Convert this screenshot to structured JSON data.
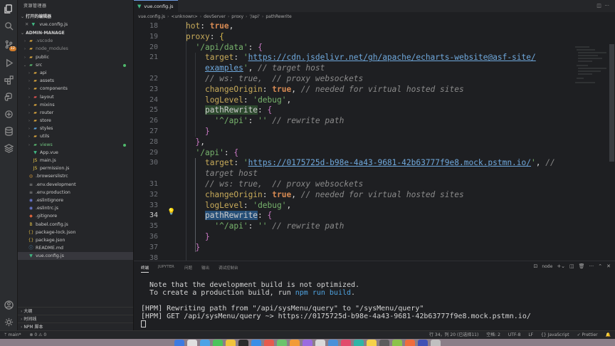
{
  "sidebar": {
    "title": "资源管理器",
    "open_editors_label": "打开的编辑器",
    "open_editors": [
      {
        "close": "✕",
        "name": "vue.config.js"
      }
    ],
    "project_label": "ADMIN-MANAGE",
    "tree": [
      {
        "name": ".vscode",
        "kind": "folder",
        "depth": 1,
        "chev": "›"
      },
      {
        "name": "node_modules",
        "kind": "folder",
        "depth": 1,
        "chev": "›"
      },
      {
        "name": "public",
        "kind": "folder",
        "depth": 1,
        "chev": "›"
      },
      {
        "name": "src",
        "kind": "folder-src",
        "depth": 1,
        "chev": "⌄",
        "dot": true
      },
      {
        "name": "api",
        "kind": "folder",
        "depth": 2,
        "chev": "›"
      },
      {
        "name": "assets",
        "kind": "folder",
        "depth": 2,
        "chev": "›"
      },
      {
        "name": "components",
        "kind": "folder",
        "depth": 2,
        "chev": "›"
      },
      {
        "name": "layout",
        "kind": "folder-red",
        "depth": 2,
        "chev": "›"
      },
      {
        "name": "mixins",
        "kind": "folder",
        "depth": 2,
        "chev": "›"
      },
      {
        "name": "router",
        "kind": "folder",
        "depth": 2,
        "chev": "›"
      },
      {
        "name": "store",
        "kind": "folder",
        "depth": 2,
        "chev": "›"
      },
      {
        "name": "styles",
        "kind": "folder-blue",
        "depth": 2,
        "chev": "›"
      },
      {
        "name": "utils",
        "kind": "folder",
        "depth": 2,
        "chev": "›"
      },
      {
        "name": "views",
        "kind": "folder-src",
        "depth": 2,
        "chev": "›",
        "dot": true,
        "green": true
      },
      {
        "name": "App.vue",
        "kind": "vue",
        "depth": 2
      },
      {
        "name": "main.js",
        "kind": "js",
        "depth": 2
      },
      {
        "name": "permission.js",
        "kind": "js",
        "depth": 2
      },
      {
        "name": ".browserslistrc",
        "kind": "browsers",
        "depth": 1
      },
      {
        "name": ".env.development",
        "kind": "env",
        "depth": 1
      },
      {
        "name": ".env.production",
        "kind": "env",
        "depth": 1
      },
      {
        "name": ".eslintignore",
        "kind": "eslint",
        "depth": 1
      },
      {
        "name": ".eslintrc.js",
        "kind": "eslint",
        "depth": 1
      },
      {
        "name": ".gitignore",
        "kind": "git",
        "depth": 1
      },
      {
        "name": "babel.config.js",
        "kind": "babel",
        "depth": 1
      },
      {
        "name": "package-lock.json",
        "kind": "json",
        "depth": 1
      },
      {
        "name": "package.json",
        "kind": "json",
        "depth": 1
      },
      {
        "name": "README.md",
        "kind": "md",
        "depth": 1
      },
      {
        "name": "vue.config.js",
        "kind": "vue",
        "depth": 1
      }
    ],
    "bottom_sections": [
      "大纲",
      "时间线",
      "NPM 脚本"
    ]
  },
  "editor": {
    "tab_label": "vue.config.js",
    "breadcrumbs": [
      "vue.config.js",
      "<unknown>",
      "devServer",
      "proxy",
      "'/api'",
      "pathRewrite"
    ],
    "lines": [
      {
        "n": "18",
        "tokens": [
          [
            "k",
            "hot"
          ],
          [
            "t",
            ": "
          ],
          [
            "kw",
            "true"
          ],
          [
            "t",
            ","
          ]
        ]
      },
      {
        "n": "19",
        "tokens": [
          [
            "k",
            "proxy"
          ],
          [
            "t",
            ": "
          ],
          [
            "br1",
            "{"
          ]
        ]
      },
      {
        "n": "20",
        "tokens": [
          [
            "t",
            "  "
          ],
          [
            "s",
            "'/api/data'"
          ],
          [
            "t",
            ": "
          ],
          [
            "br2",
            "{"
          ]
        ]
      },
      {
        "n": "21",
        "tokens": [
          [
            "t",
            "    "
          ],
          [
            "k",
            "target"
          ],
          [
            "t",
            ": "
          ],
          [
            "s",
            "'"
          ],
          [
            "u",
            "https://cdn.jsdelivr.net/gh/apache/echarts-website@asf-site/"
          ]
        ]
      },
      {
        "n": "",
        "tokens": [
          [
            "t",
            "    "
          ],
          [
            "u",
            "examples"
          ],
          [
            "s",
            "'"
          ],
          [
            "t",
            ", "
          ],
          [
            "cm",
            "// target host"
          ]
        ]
      },
      {
        "n": "22",
        "tokens": [
          [
            "t",
            "    "
          ],
          [
            "cm",
            "// ws: true,  // proxy websockets"
          ]
        ]
      },
      {
        "n": "23",
        "tokens": [
          [
            "t",
            "    "
          ],
          [
            "k",
            "changeOrigin"
          ],
          [
            "t",
            ": "
          ],
          [
            "kw",
            "true"
          ],
          [
            "t",
            ", "
          ],
          [
            "cm",
            "// needed for virtual hosted sites"
          ]
        ]
      },
      {
        "n": "24",
        "tokens": [
          [
            "t",
            "    "
          ],
          [
            "k",
            "logLevel"
          ],
          [
            "t",
            ": "
          ],
          [
            "s",
            "'debug'"
          ],
          [
            "t",
            ","
          ]
        ]
      },
      {
        "n": "25",
        "tokens": [
          [
            "t",
            "    "
          ],
          [
            "hl",
            "pathRewrite"
          ],
          [
            "t",
            ": "
          ],
          [
            "br2",
            "{"
          ]
        ]
      },
      {
        "n": "26",
        "tokens": [
          [
            "t",
            "      "
          ],
          [
            "s",
            "'^/api'"
          ],
          [
            "t",
            ": "
          ],
          [
            "s",
            "''"
          ],
          [
            "t",
            " "
          ],
          [
            "cm",
            "// rewrite path"
          ]
        ]
      },
      {
        "n": "27",
        "tokens": [
          [
            "t",
            "    "
          ],
          [
            "br2",
            "}"
          ]
        ]
      },
      {
        "n": "28",
        "tokens": [
          [
            "t",
            "  "
          ],
          [
            "br2",
            "}"
          ],
          [
            "t",
            ","
          ]
        ]
      },
      {
        "n": "29",
        "tokens": [
          [
            "t",
            "  "
          ],
          [
            "s",
            "'/api'"
          ],
          [
            "t",
            ": "
          ],
          [
            "br2",
            "{"
          ]
        ]
      },
      {
        "n": "30",
        "tokens": [
          [
            "t",
            "    "
          ],
          [
            "k",
            "target"
          ],
          [
            "t",
            ": "
          ],
          [
            "s",
            "'"
          ],
          [
            "u",
            "https://0175725d-b98e-4a43-9681-42b63777f9e8.mock.pstmn.io/"
          ],
          [
            "s",
            "'"
          ],
          [
            "t",
            ", "
          ],
          [
            "cm",
            "//"
          ]
        ]
      },
      {
        "n": "",
        "tokens": [
          [
            "t",
            "    "
          ],
          [
            "cm",
            "target host"
          ]
        ]
      },
      {
        "n": "31",
        "tokens": [
          [
            "t",
            "    "
          ],
          [
            "cm",
            "// ws: true,  // proxy websockets"
          ]
        ]
      },
      {
        "n": "32",
        "tokens": [
          [
            "t",
            "    "
          ],
          [
            "k",
            "changeOrigin"
          ],
          [
            "t",
            ": "
          ],
          [
            "kw",
            "true"
          ],
          [
            "t",
            ", "
          ],
          [
            "cm",
            "// needed for virtual hosted sites"
          ]
        ]
      },
      {
        "n": "33",
        "tokens": [
          [
            "t",
            "    "
          ],
          [
            "k",
            "logLevel"
          ],
          [
            "t",
            ": "
          ],
          [
            "s",
            "'debug'"
          ],
          [
            "t",
            ","
          ]
        ]
      },
      {
        "n": "34",
        "cur": true,
        "tokens": [
          [
            "t",
            "    "
          ],
          [
            "hlsel",
            "pathRewrite"
          ],
          [
            "t",
            ": "
          ],
          [
            "br2",
            "{"
          ]
        ]
      },
      {
        "n": "35",
        "tokens": [
          [
            "t",
            "      "
          ],
          [
            "s",
            "'^/api'"
          ],
          [
            "t",
            ": "
          ],
          [
            "s",
            "''"
          ],
          [
            "t",
            " "
          ],
          [
            "cm",
            "// rewrite path"
          ]
        ]
      },
      {
        "n": "36",
        "tokens": [
          [
            "t",
            "    "
          ],
          [
            "br2",
            "}"
          ]
        ]
      },
      {
        "n": "37",
        "tokens": [
          [
            "t",
            "  "
          ],
          [
            "br2",
            "}"
          ]
        ]
      },
      {
        "n": "38",
        "tokens": []
      }
    ]
  },
  "panel": {
    "tabs": [
      "终端",
      "JUPYTER",
      "问题",
      "输出",
      "调试控制台"
    ],
    "terminal_name": "node",
    "terminal_lines": [
      [
        [
          "t",
          "  Note that the development build is not optimized."
        ]
      ],
      [
        [
          "t",
          "  To create a production build, run "
        ],
        [
          "blue",
          "npm run build"
        ],
        [
          "t",
          "."
        ]
      ],
      [
        [
          "t",
          ""
        ]
      ],
      [
        [
          "t",
          "[HPM] Rewriting path from \"/api/sysMenu/query\" to \"/sysMenu/query\""
        ]
      ],
      [
        [
          "t",
          "[HPM] GET /api/sysMenu/query ~> https://0175725d-b98e-4a43-9681-42b63777f9e8.mock.pstmn.io/"
        ]
      ]
    ]
  },
  "status": {
    "left": [
      "main*",
      "⊗ 0 ⚠ 0"
    ],
    "right": [
      "行 34，列 20 (已选择11)",
      "空格: 2",
      "UTF-8",
      "LF",
      "{} JavaScript",
      "✓ Prettier"
    ]
  },
  "colors": {
    "accent": "#6e9ce0",
    "keyword": "#d78a53",
    "string": "#77b36c",
    "comment": "#8a8a8a",
    "property": "#c8ab5a"
  }
}
